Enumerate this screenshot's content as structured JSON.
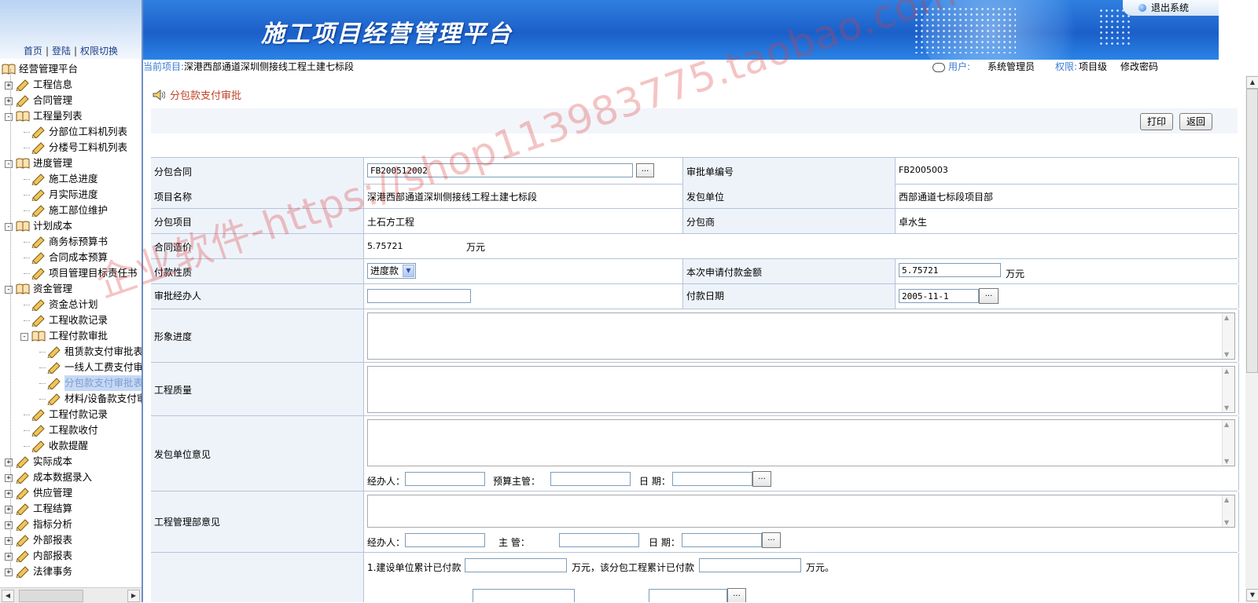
{
  "app": {
    "title": "施工项目经营管理平台",
    "logout": "退出系统"
  },
  "left_links": [
    "首页",
    "登陆",
    "权限切换"
  ],
  "tree": [
    {
      "label": "经营管理平台",
      "level": 0,
      "toggle": "",
      "icon": "book-open-icon"
    },
    {
      "label": "工程信息",
      "level": 1,
      "toggle": "+",
      "icon": "pencil-icon"
    },
    {
      "label": "合同管理",
      "level": 1,
      "toggle": "+",
      "icon": "pencil-icon"
    },
    {
      "label": "工程量列表",
      "level": 1,
      "toggle": "-",
      "icon": "book-open-icon"
    },
    {
      "label": "分部位工料机列表",
      "level": 2,
      "toggle": "",
      "icon": "pencil-icon"
    },
    {
      "label": "分楼号工料机列表",
      "level": 2,
      "toggle": "",
      "icon": "pencil-icon"
    },
    {
      "label": "进度管理",
      "level": 1,
      "toggle": "-",
      "icon": "book-open-icon"
    },
    {
      "label": "施工总进度",
      "level": 2,
      "toggle": "",
      "icon": "pencil-icon"
    },
    {
      "label": "月实际进度",
      "level": 2,
      "toggle": "",
      "icon": "pencil-icon"
    },
    {
      "label": "施工部位维护",
      "level": 2,
      "toggle": "",
      "icon": "pencil-icon"
    },
    {
      "label": "计划成本",
      "level": 1,
      "toggle": "-",
      "icon": "book-open-icon"
    },
    {
      "label": "商务标预算书",
      "level": 2,
      "toggle": "",
      "icon": "pencil-icon"
    },
    {
      "label": "合同成本预算",
      "level": 2,
      "toggle": "",
      "icon": "pencil-icon"
    },
    {
      "label": "项目管理目标责任书",
      "level": 2,
      "toggle": "",
      "icon": "pencil-icon"
    },
    {
      "label": "资金管理",
      "level": 1,
      "toggle": "-",
      "icon": "book-open-icon"
    },
    {
      "label": "资金总计划",
      "level": 2,
      "toggle": "",
      "icon": "pencil-icon"
    },
    {
      "label": "工程收款记录",
      "level": 2,
      "toggle": "",
      "icon": "pencil-icon"
    },
    {
      "label": "工程付款审批",
      "level": 2,
      "toggle": "-",
      "icon": "book-open-icon"
    },
    {
      "label": "租赁款支付审批表",
      "level": 3,
      "toggle": "",
      "icon": "pencil-icon"
    },
    {
      "label": "一线人工费支付审批",
      "level": 3,
      "toggle": "",
      "icon": "pencil-icon"
    },
    {
      "label": "分包款支付审批表",
      "level": 3,
      "toggle": "",
      "icon": "pencil-icon",
      "selected": true
    },
    {
      "label": "材料/设备款支付审批",
      "level": 3,
      "toggle": "",
      "icon": "pencil-icon"
    },
    {
      "label": "工程付款记录",
      "level": 2,
      "toggle": "",
      "icon": "pencil-icon"
    },
    {
      "label": "工程款收付",
      "level": 2,
      "toggle": "",
      "icon": "pencil-icon"
    },
    {
      "label": "收款提醒",
      "level": 2,
      "toggle": "",
      "icon": "pencil-icon"
    },
    {
      "label": "实际成本",
      "level": 1,
      "toggle": "+",
      "icon": "pencil-icon"
    },
    {
      "label": "成本数据录入",
      "level": 1,
      "toggle": "+",
      "icon": "pencil-icon"
    },
    {
      "label": "供应管理",
      "level": 1,
      "toggle": "+",
      "icon": "pencil-icon"
    },
    {
      "label": "工程结算",
      "level": 1,
      "toggle": "+",
      "icon": "pencil-icon"
    },
    {
      "label": "指标分析",
      "level": 1,
      "toggle": "+",
      "icon": "pencil-icon"
    },
    {
      "label": "外部报表",
      "level": 1,
      "toggle": "+",
      "icon": "pencil-icon"
    },
    {
      "label": "内部报表",
      "level": 1,
      "toggle": "+",
      "icon": "pencil-icon"
    },
    {
      "label": "法律事务",
      "level": 1,
      "toggle": "+",
      "icon": "pencil-icon"
    }
  ],
  "infobar": {
    "current_project_label": "当前项目:",
    "current_project": "深港西部通道深圳侧接线工程土建七标段",
    "user_label": "用户:",
    "user": "系统管理员",
    "role_label": "权限:",
    "role": "项目级",
    "change_password": "修改密码"
  },
  "page": {
    "title": "分包款支付审批",
    "print_button": "打印",
    "back_button": "返回"
  },
  "form": {
    "contract_label": "分包合同",
    "contract_value": "FB200512002",
    "approval_no_label": "审批单编号",
    "approval_no": "FB2005003",
    "project_name_label": "项目名称",
    "project_name": "深港西部通道深圳侧接线工程土建七标段",
    "contractor_label": "发包单位",
    "contractor": "西部通道七标段项目部",
    "sub_item_label": "分包项目",
    "sub_item": "土石方工程",
    "subcontractor_label": "分包商",
    "subcontractor": "卓水生",
    "contract_price_label": "合同造价",
    "contract_price": "5.75721",
    "unit_wan": "万元",
    "payment_type_label": "付款性质",
    "payment_type": "进度款",
    "apply_amount_label": "本次申请付款金额",
    "apply_amount": "5.75721",
    "handler_label": "审批经办人",
    "handler": "",
    "pay_date_label": "付款日期",
    "pay_date": "2005-11-1",
    "progress_label": "形象进度",
    "quality_label": "工程质量",
    "contractor_opinion_label": "发包单位意见",
    "dept_opinion_label": "工程管理部意见",
    "agent_label": "经办人：",
    "budget_supervisor_label": "预算主管：",
    "date_label": "日 期：",
    "supervisor_label": "主 管：",
    "item1_prefix": "1.建设单位累计已付款",
    "item1_mid": "万元，该分包工程累计已付款",
    "item1_suffix": "万元。",
    "dots": "..."
  }
}
